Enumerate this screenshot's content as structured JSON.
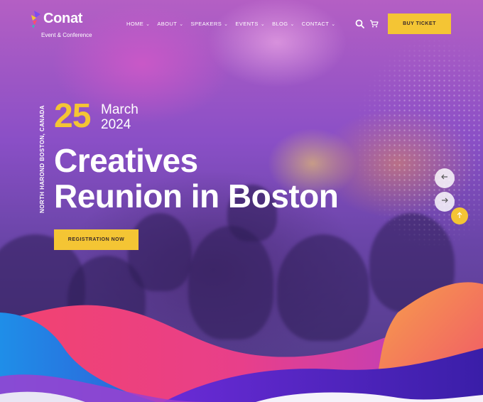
{
  "brand": {
    "name": "Conat",
    "tagline": "Event & Conference",
    "accent": "#f4c534"
  },
  "nav": {
    "items": [
      {
        "label": "HOME"
      },
      {
        "label": "ABOUT"
      },
      {
        "label": "SPEAKERS"
      },
      {
        "label": "EVENTS"
      },
      {
        "label": "BLOG"
      },
      {
        "label": "CONTACT"
      }
    ],
    "search_icon": "search-icon",
    "cart_icon": "cart-icon",
    "buy_label": "BUY TICKET"
  },
  "hero": {
    "location": "NORTH HAROND BOSTON, CANADA",
    "day": "25",
    "month": "March",
    "year": "2024",
    "title_line1": "Creatives",
    "title_line2": "Reunion in Boston",
    "cta_label": "REGISTRATION NOW"
  },
  "controls": {
    "prev_icon": "arrow-left-icon",
    "next_icon": "arrow-right-icon",
    "top_icon": "arrow-up-icon"
  }
}
